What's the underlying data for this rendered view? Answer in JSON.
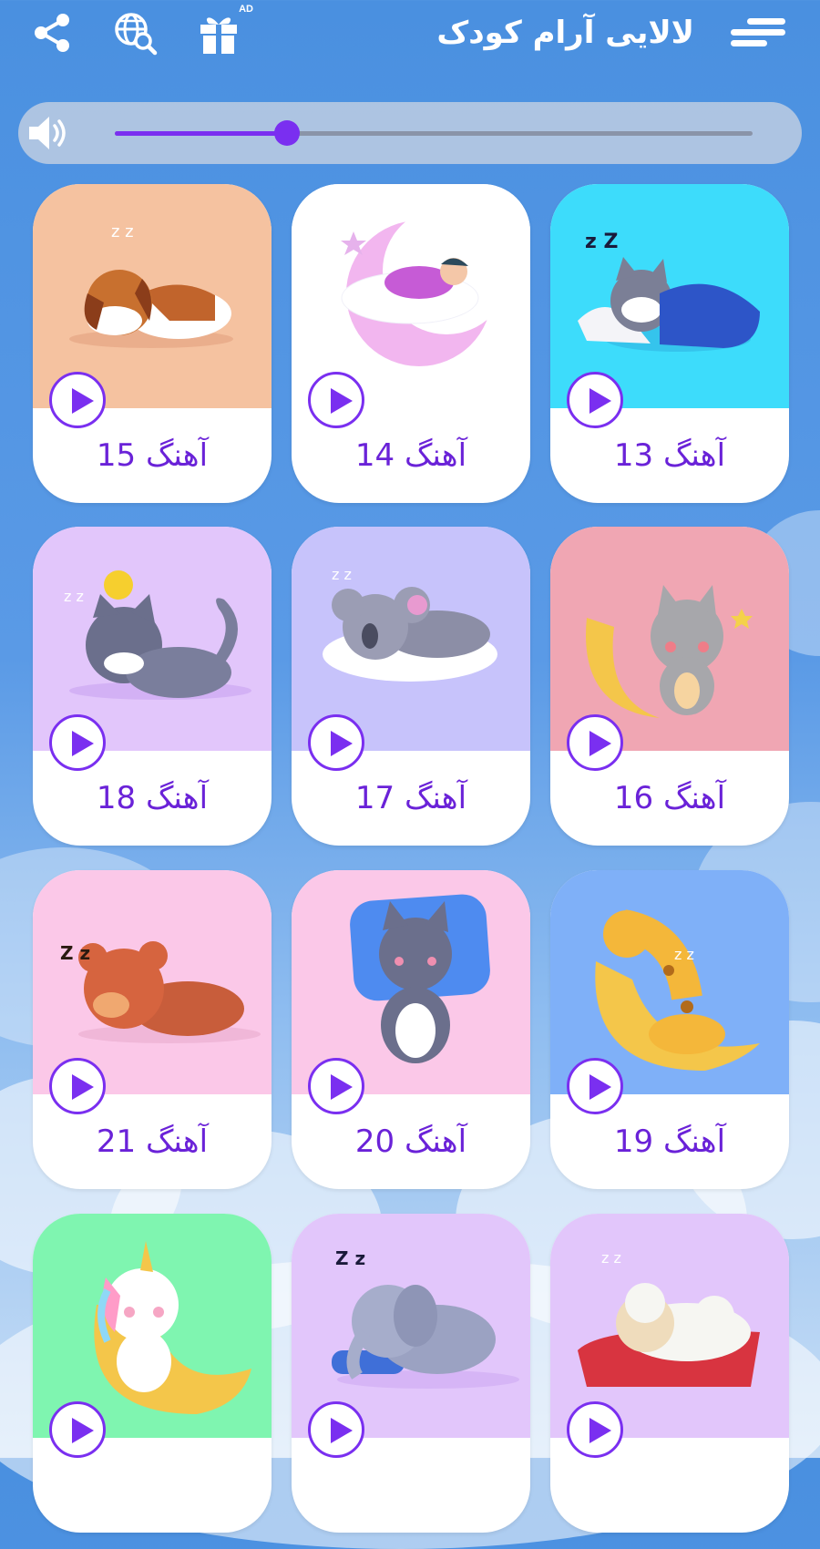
{
  "header": {
    "title": "لالایی آرام کودک",
    "ad_badge": "AD",
    "icons": [
      "share-icon",
      "web-search-icon",
      "gift-icon",
      "menu-icon"
    ]
  },
  "volume": {
    "level": 0.27,
    "icon": "speaker-icon",
    "accent": "#7a2ff0"
  },
  "songs": [
    {
      "label": "آهنگ 13",
      "bg": "#3ddcfb",
      "art": "cat-blanket"
    },
    {
      "label": "آهنگ 14",
      "bg": "#ffffff",
      "art": "baby-moon"
    },
    {
      "label": "آهنگ 15",
      "bg": "#f5c2a0",
      "art": "dog"
    },
    {
      "label": "آهنگ 16",
      "bg": "#f0a6b3",
      "art": "cat-moon"
    },
    {
      "label": "آهنگ 17",
      "bg": "#c7c3fb",
      "art": "koala"
    },
    {
      "label": "آهنگ 18",
      "bg": "#e2c6fb",
      "art": "cat-chick"
    },
    {
      "label": "آهنگ 19",
      "bg": "#7fb0f8",
      "art": "giraffe-moon"
    },
    {
      "label": "آهنگ 20",
      "bg": "#fbc8e8",
      "art": "cat-pillow"
    },
    {
      "label": "آهنگ 21",
      "bg": "#fbc8e8",
      "art": "bear"
    },
    {
      "label": "",
      "bg": "#e2c6fb",
      "art": "sheep"
    },
    {
      "label": "",
      "bg": "#e2c6fb",
      "art": "elephant"
    },
    {
      "label": "",
      "bg": "#7ff5b0",
      "art": "unicorn-moon"
    }
  ]
}
